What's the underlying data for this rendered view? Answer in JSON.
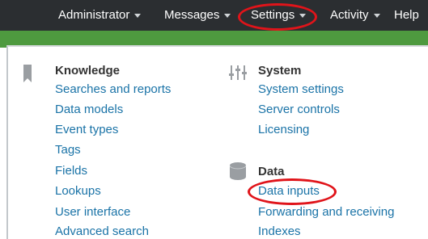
{
  "topnav": {
    "items": [
      {
        "label": "Administrator"
      },
      {
        "label": "Messages"
      },
      {
        "label": "Settings"
      },
      {
        "label": "Activity"
      },
      {
        "label": "Help"
      }
    ]
  },
  "menu": {
    "knowledge": {
      "heading": "Knowledge",
      "links": [
        "Searches and reports",
        "Data models",
        "Event types",
        "Tags",
        "Fields",
        "Lookups",
        "User interface",
        "Advanced search"
      ]
    },
    "system": {
      "heading": "System",
      "links": [
        "System settings",
        "Server controls",
        "Licensing"
      ]
    },
    "data": {
      "heading": "Data",
      "links": [
        "Data inputs",
        "Forwarding and receiving",
        "Indexes"
      ]
    }
  },
  "colors": {
    "topbar": "#2b2e31",
    "accent_green": "#4e9a3f",
    "link": "#1a73a7",
    "annotation_red": "#e0141a"
  },
  "icons": {
    "knowledge": "bookmark-icon",
    "system": "sliders-icon",
    "data": "database-icon"
  }
}
